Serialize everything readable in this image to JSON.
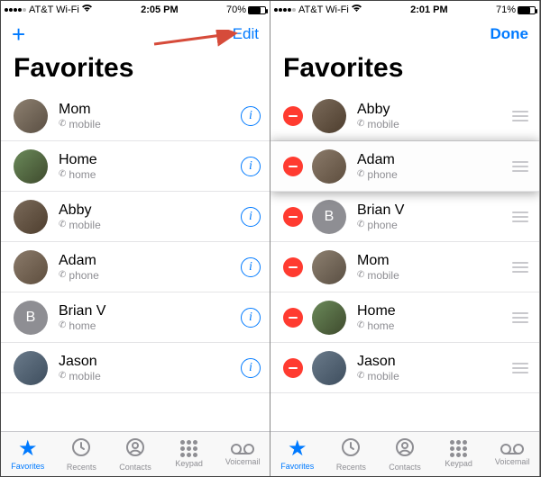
{
  "left": {
    "status": {
      "carrier": "AT&T Wi-Fi",
      "time": "2:05 PM",
      "battery_pct": "70%",
      "battery_level": 70
    },
    "nav": {
      "plus": "+",
      "right": "Edit"
    },
    "title": "Favorites",
    "contacts": [
      {
        "name": "Mom",
        "type": "mobile",
        "avatar": "photo"
      },
      {
        "name": "Home",
        "type": "home",
        "avatar": "photo2"
      },
      {
        "name": "Abby",
        "type": "mobile",
        "avatar": "photo3"
      },
      {
        "name": "Adam",
        "type": "phone",
        "avatar": "photo4"
      },
      {
        "name": "Brian V",
        "type": "home",
        "avatar": "letter",
        "letter": "B"
      },
      {
        "name": "Jason",
        "type": "mobile",
        "avatar": "photo5"
      }
    ],
    "tabs": [
      {
        "id": "favorites",
        "label": "Favorites",
        "active": true
      },
      {
        "id": "recents",
        "label": "Recents"
      },
      {
        "id": "contacts",
        "label": "Contacts"
      },
      {
        "id": "keypad",
        "label": "Keypad"
      },
      {
        "id": "voicemail",
        "label": "Voicemail"
      }
    ]
  },
  "right": {
    "status": {
      "carrier": "AT&T Wi-Fi",
      "time": "2:01 PM",
      "battery_pct": "71%",
      "battery_level": 71
    },
    "nav": {
      "right": "Done"
    },
    "title": "Favorites",
    "contacts": [
      {
        "name": "Abby",
        "type": "mobile",
        "avatar": "photo3"
      },
      {
        "name": "Adam",
        "type": "phone",
        "avatar": "photo4",
        "dragging": true
      },
      {
        "name": "Brian V",
        "type": "phone",
        "avatar": "letter",
        "letter": "B"
      },
      {
        "name": "Mom",
        "type": "mobile",
        "avatar": "photo"
      },
      {
        "name": "Home",
        "type": "home",
        "avatar": "photo2"
      },
      {
        "name": "Jason",
        "type": "mobile",
        "avatar": "photo5"
      }
    ],
    "tabs": [
      {
        "id": "favorites",
        "label": "Favorites",
        "active": true
      },
      {
        "id": "recents",
        "label": "Recents"
      },
      {
        "id": "contacts",
        "label": "Contacts"
      },
      {
        "id": "keypad",
        "label": "Keypad"
      },
      {
        "id": "voicemail",
        "label": "Voicemail"
      }
    ]
  }
}
